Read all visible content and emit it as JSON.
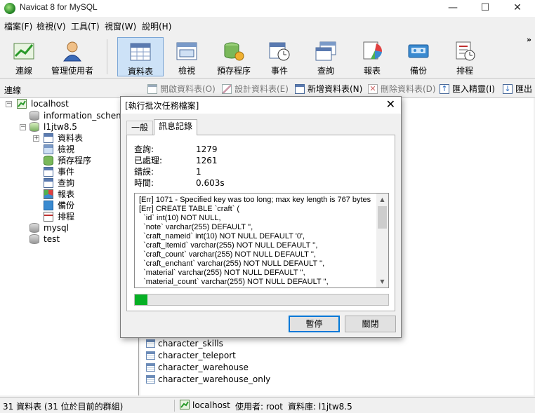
{
  "app": {
    "title": "Navicat 8 for MySQL",
    "window_controls": {
      "minimize": "—",
      "maximize": "☐",
      "close": "✕"
    }
  },
  "menu": [
    "檔案(F)",
    "檢視(V)",
    "工具(T)",
    "視窗(W)",
    "說明(H)"
  ],
  "toolbar": {
    "buttons": [
      {
        "label": "連線",
        "icon": "connection-icon"
      },
      {
        "label": "管理使用者",
        "icon": "user-icon"
      },
      {
        "label": "資料表",
        "icon": "table-icon",
        "active": true
      },
      {
        "label": "檢視",
        "icon": "view-icon"
      },
      {
        "label": "預存程序",
        "icon": "procedure-icon"
      },
      {
        "label": "事件",
        "icon": "event-icon"
      },
      {
        "label": "查詢",
        "icon": "query-icon"
      },
      {
        "label": "報表",
        "icon": "report-icon"
      },
      {
        "label": "備份",
        "icon": "backup-icon"
      },
      {
        "label": "排程",
        "icon": "schedule-icon"
      }
    ],
    "more": "»"
  },
  "connection_panel": {
    "header": "連線",
    "tree": [
      {
        "label": "localhost",
        "level": 0
      },
      {
        "label": "information_schema",
        "level": 1
      },
      {
        "label": "l1jtw8.5",
        "level": 1
      },
      {
        "label": "資料表",
        "level": 2
      },
      {
        "label": "檢視",
        "level": 2
      },
      {
        "label": "預存程序",
        "level": 2
      },
      {
        "label": "事件",
        "level": 2
      },
      {
        "label": "查詢",
        "level": 2
      },
      {
        "label": "報表",
        "level": 2
      },
      {
        "label": "備份",
        "level": 2
      },
      {
        "label": "排程",
        "level": 2
      },
      {
        "label": "mysql",
        "level": 1
      },
      {
        "label": "test",
        "level": 1
      }
    ]
  },
  "object_toolbar": [
    {
      "label": "開啟資料表(O)",
      "enabled": false
    },
    {
      "label": "設計資料表(E)",
      "enabled": false
    },
    {
      "label": "新增資料表(N)",
      "enabled": true
    },
    {
      "label": "刪除資料表(D)",
      "enabled": false
    },
    {
      "label": "匯入精靈(I)",
      "enabled": true
    },
    {
      "label": "匯出",
      "enabled": true
    }
  ],
  "object_list": [
    "character_skills",
    "character_teleport",
    "character_warehouse",
    "character_warehouse_only"
  ],
  "statusbar": {
    "count": "31 資料表 (31 位於目前的群組)",
    "connection": "localhost",
    "user": "使用者: root",
    "database": "資料庫: l1jtw8.5"
  },
  "dialog": {
    "title": "[執行批次任務檔案]",
    "close": "✕",
    "tabs": [
      "一般",
      "訊息記錄"
    ],
    "active_tab": 1,
    "stats": [
      {
        "label": "查詢:",
        "value": "1279"
      },
      {
        "label": "已處理:",
        "value": "1261"
      },
      {
        "label": "錯誤:",
        "value": "1"
      },
      {
        "label": "時間:",
        "value": "0.603s"
      }
    ],
    "log": [
      "[Err] 1071 - Specified key was too long; max key length is 767 bytes",
      "[Err] CREATE TABLE `craft` (",
      "  `id` int(10) NOT NULL,",
      "  `note` varchar(255) DEFAULT '',",
      "  `craft_nameid` int(10) NOT NULL DEFAULT '0',",
      "  `craft_itemid` varchar(255) NOT NULL DEFAULT '',",
      "  `craft_count` varchar(255) NOT NULL DEFAULT '',",
      "  `craft_enchant` varchar(255) NOT NULL DEFAULT '',",
      "  `material` varchar(255) NOT NULL DEFAULT '',",
      "  `material_count` varchar(255) NOT NULL DEFAULT '',"
    ],
    "progress_fraction": 0.05,
    "buttons": {
      "pause": "暫停",
      "close": "關閉"
    }
  }
}
